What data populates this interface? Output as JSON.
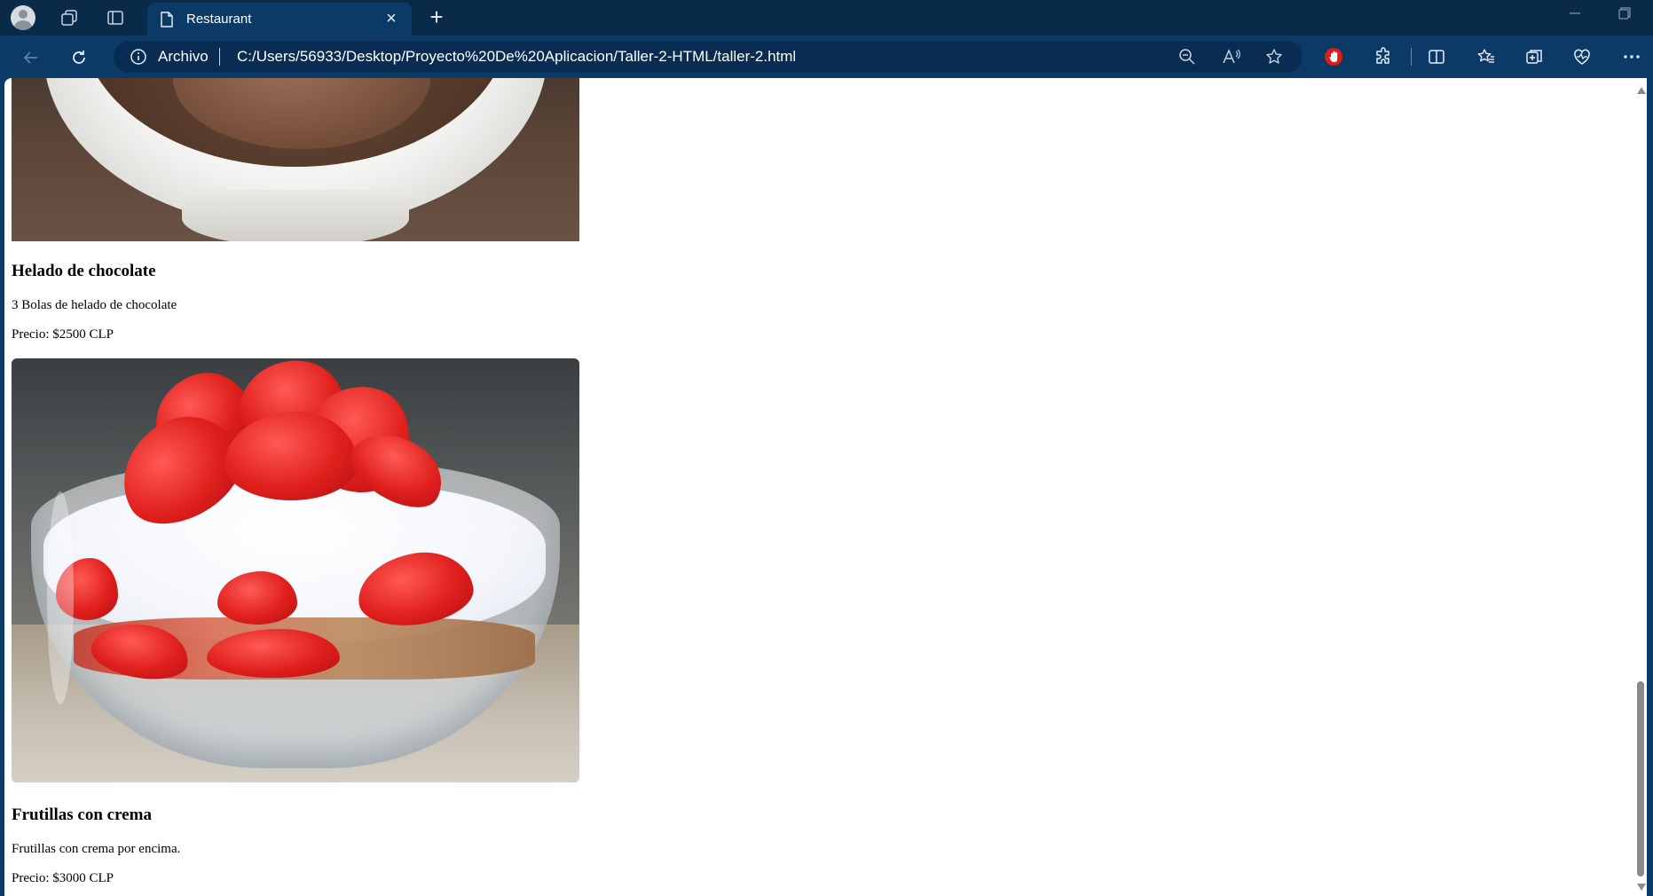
{
  "browser": {
    "tab": {
      "title": "Restaurant"
    },
    "address": {
      "scheme_label": "Archivo",
      "url": "C:/Users/56933/Desktop/Proyecto%20De%20Aplicacion/Taller-2-HTML/taller-2.html"
    }
  },
  "page": {
    "items": [
      {
        "name": "Helado de chocolate",
        "description": "3 Bolas de helado de chocolate",
        "price": "Precio: $2500 CLP"
      },
      {
        "name": "Frutillas con crema",
        "description": "Frutillas con crema por encima.",
        "price": "Precio: $3000 CLP"
      }
    ]
  },
  "scrollbar": {
    "position_fraction": 0.95
  },
  "colors": {
    "tabbar": "#0a2a4a",
    "toolbar": "#0b3a66",
    "adblock_red": "#e01919"
  }
}
